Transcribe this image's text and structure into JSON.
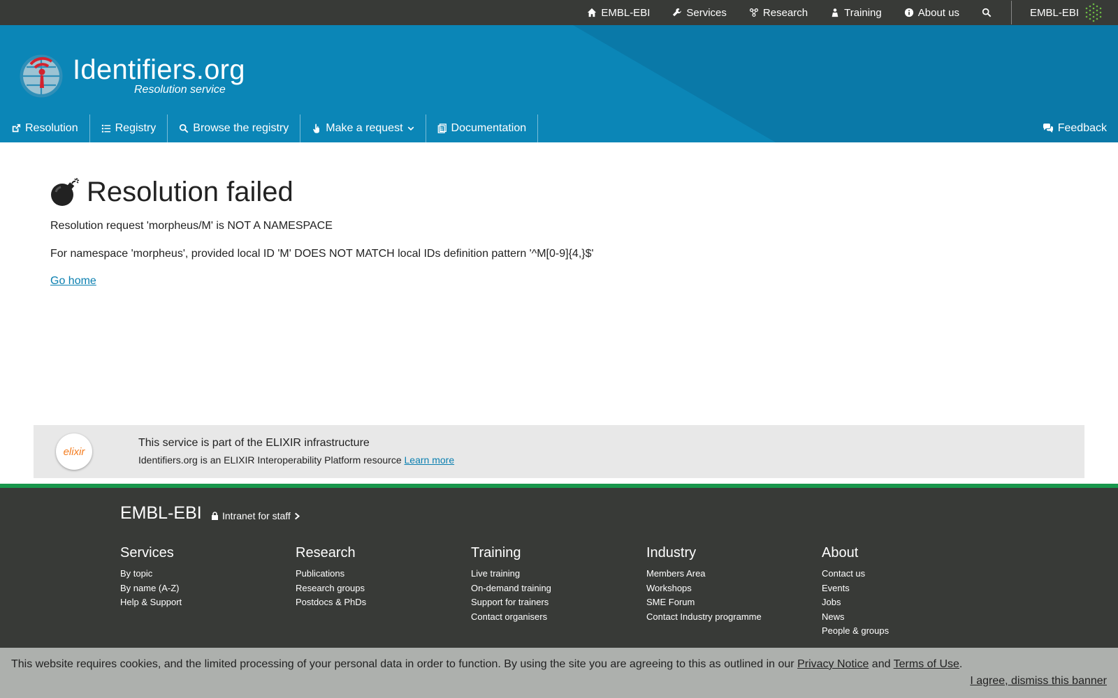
{
  "topbar": {
    "items": [
      {
        "label": "EMBL-EBI",
        "icon": "home-icon"
      },
      {
        "label": "Services",
        "icon": "wrench-icon"
      },
      {
        "label": "Research",
        "icon": "research-icon"
      },
      {
        "label": "Training",
        "icon": "training-icon"
      },
      {
        "label": "About us",
        "icon": "info-icon"
      }
    ],
    "search_icon": "search-icon",
    "brand": "EMBL-EBI"
  },
  "masthead": {
    "title": "Identifiers.org",
    "subtitle": "Resolution service",
    "nav": [
      {
        "label": "Resolution",
        "icon": "external-link-icon"
      },
      {
        "label": "Registry",
        "icon": "list-icon"
      },
      {
        "label": "Browse the registry",
        "icon": "search-icon"
      },
      {
        "label": "Make a request",
        "icon": "hand-pointer-icon",
        "dropdown": true
      },
      {
        "label": "Documentation",
        "icon": "document-icon"
      }
    ],
    "feedback": "Feedback"
  },
  "main": {
    "heading": "Resolution failed",
    "message1": "Resolution request 'morpheus/M' is NOT A NAMESPACE",
    "message2": "For namespace 'morpheus', provided local ID 'M' DOES NOT MATCH local IDs definition pattern '^M[0-9]{4,}$'",
    "go_home": "Go home"
  },
  "elixir": {
    "badge": "elixir",
    "title": "This service is part of the ELIXIR infrastructure",
    "text": "Identifiers.org is an ELIXIR Interoperability Platform resource",
    "learn_more": "Learn more"
  },
  "footer": {
    "brand": "EMBL-EBI",
    "intranet": "Intranet for staff",
    "columns": [
      {
        "title": "Services",
        "links": [
          "By topic",
          "By name (A-Z)",
          "Help & Support"
        ]
      },
      {
        "title": "Research",
        "links": [
          "Publications",
          "Research groups",
          "Postdocs & PhDs"
        ]
      },
      {
        "title": "Training",
        "links": [
          "Live training",
          "On-demand training",
          "Support for trainers",
          "Contact organisers"
        ]
      },
      {
        "title": "Industry",
        "links": [
          "Members Area",
          "Workshops",
          "SME Forum",
          "Contact Industry programme"
        ]
      },
      {
        "title": "About",
        "links": [
          "Contact us",
          "Events",
          "Jobs",
          "News",
          "People & groups"
        ]
      }
    ]
  },
  "cookie": {
    "text": "This website requires cookies, and the limited processing of your personal data in order to function. By using the site you are agreeing to this as outlined in our",
    "privacy": "Privacy Notice",
    "and": "and",
    "terms": "Terms of Use",
    "period": ".",
    "dismiss": "I agree, dismiss this banner"
  },
  "colors": {
    "topbar": "#383a37",
    "masthead": "#0b86b7",
    "footer_rule": "#18974c",
    "link": "#0a7fb0"
  }
}
